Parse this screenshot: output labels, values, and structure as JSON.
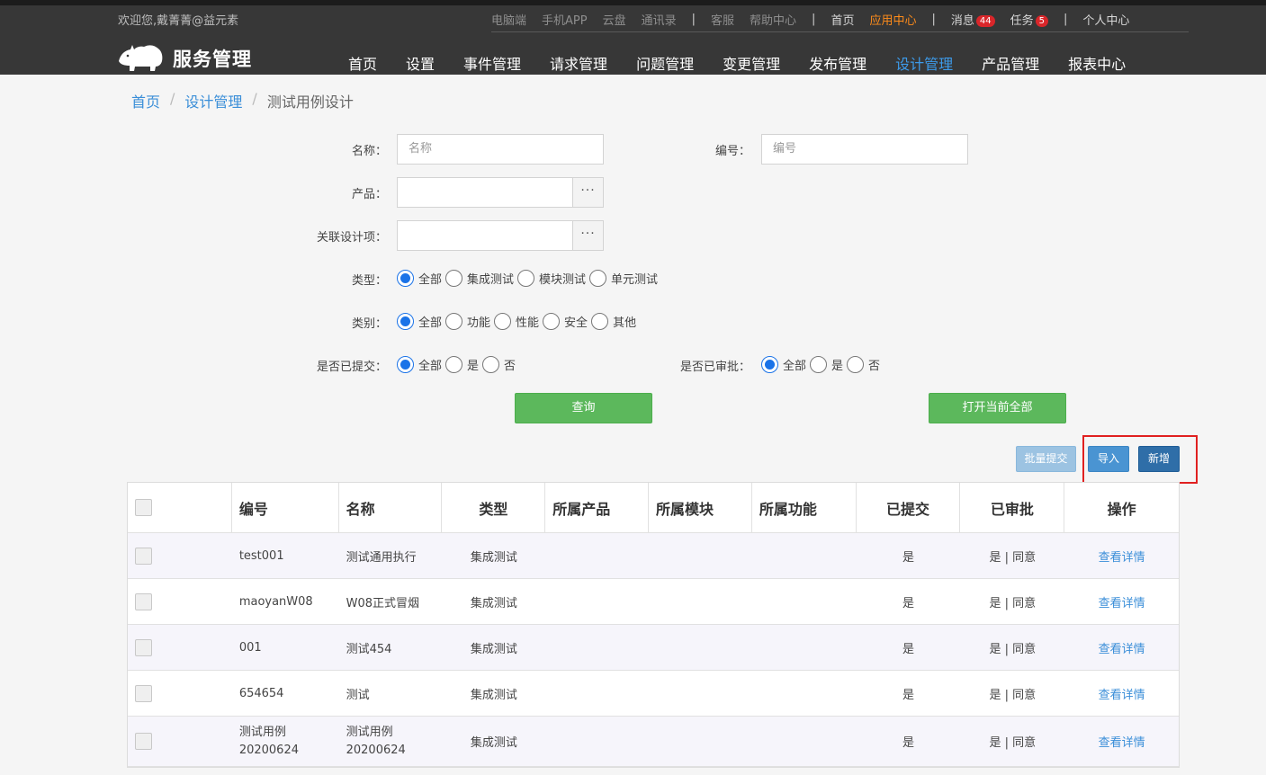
{
  "topbar": {
    "welcome": "欢迎您,戴菁菁@益元素",
    "links": [
      {
        "label": "电脑端",
        "style": "dim"
      },
      {
        "label": "手机APP",
        "style": "dim"
      },
      {
        "label": "云盘",
        "style": "dim"
      },
      {
        "label": "通讯录",
        "style": "dim"
      },
      {
        "label": "|",
        "style": "sep"
      },
      {
        "label": "客服",
        "style": "dim"
      },
      {
        "label": "帮助中心",
        "style": "dim"
      },
      {
        "label": "|",
        "style": "sep"
      },
      {
        "label": "首页",
        "style": "light"
      },
      {
        "label": "应用中心",
        "style": "accent"
      },
      {
        "label": "|",
        "style": "sep"
      },
      {
        "label": "消息",
        "style": "light",
        "badge": "44"
      },
      {
        "label": "任务",
        "style": "light",
        "badge": "5"
      },
      {
        "label": "|",
        "style": "sep"
      },
      {
        "label": "个人中心",
        "style": "light"
      }
    ]
  },
  "logo": {
    "text": "服务管理",
    "icon": "rhino-icon"
  },
  "nav": {
    "items": [
      "首页",
      "设置",
      "事件管理",
      "请求管理",
      "问题管理",
      "变更管理",
      "发布管理",
      "设计管理",
      "产品管理",
      "报表中心"
    ],
    "active": "设计管理"
  },
  "breadcrumb": {
    "items": [
      "首页",
      "设计管理"
    ],
    "current": "测试用例设计"
  },
  "form": {
    "name_label": "名称：",
    "name_placeholder": "名称",
    "code_label": "编号：",
    "code_placeholder": "编号",
    "product_label": "产品：",
    "related_label": "关联设计项：",
    "picker_button": "···",
    "type_label": "类型：",
    "type_options": [
      "全部",
      "集成测试",
      "模块测试",
      "单元测试"
    ],
    "category_label": "类别：",
    "category_options": [
      "全部",
      "功能",
      "性能",
      "安全",
      "其他"
    ],
    "submitted_label": "是否已提交：",
    "submitted_options": [
      "全部",
      "是",
      "否"
    ],
    "approved_label": "是否已审批：",
    "approved_options": [
      "全部",
      "是",
      "否"
    ],
    "query_button": "查询",
    "open_all_button": "打开当前全部"
  },
  "actions": {
    "batch_submit": "批量提交",
    "import": "导入",
    "add": "新增"
  },
  "table": {
    "headers": [
      "",
      "编号",
      "名称",
      "类型",
      "所属产品",
      "所属模块",
      "所属功能",
      "已提交",
      "已审批",
      "操作"
    ],
    "rows": [
      {
        "code": "test001",
        "name": "测试通用执行",
        "type": "集成测试",
        "product": "",
        "module": "",
        "function": "",
        "submitted": "是",
        "approved": "是 | 同意",
        "action": "查看详情"
      },
      {
        "code": "maoyanW08",
        "name": "W08正式冒烟",
        "type": "集成测试",
        "product": "",
        "module": "",
        "function": "",
        "submitted": "是",
        "approved": "是 | 同意",
        "action": "查看详情"
      },
      {
        "code": "001",
        "name": "测试454",
        "type": "集成测试",
        "product": "",
        "module": "",
        "function": "",
        "submitted": "是",
        "approved": "是 | 同意",
        "action": "查看详情"
      },
      {
        "code": "654654",
        "name": "测试",
        "type": "集成测试",
        "product": "",
        "module": "",
        "function": "",
        "submitted": "是",
        "approved": "是 | 同意",
        "action": "查看详情"
      },
      {
        "code": "测试用例 20200624",
        "name": "测试用例 20200624",
        "type": "集成测试",
        "product": "",
        "module": "",
        "function": "",
        "submitted": "是",
        "approved": "是 | 同意",
        "action": "查看详情"
      }
    ]
  }
}
